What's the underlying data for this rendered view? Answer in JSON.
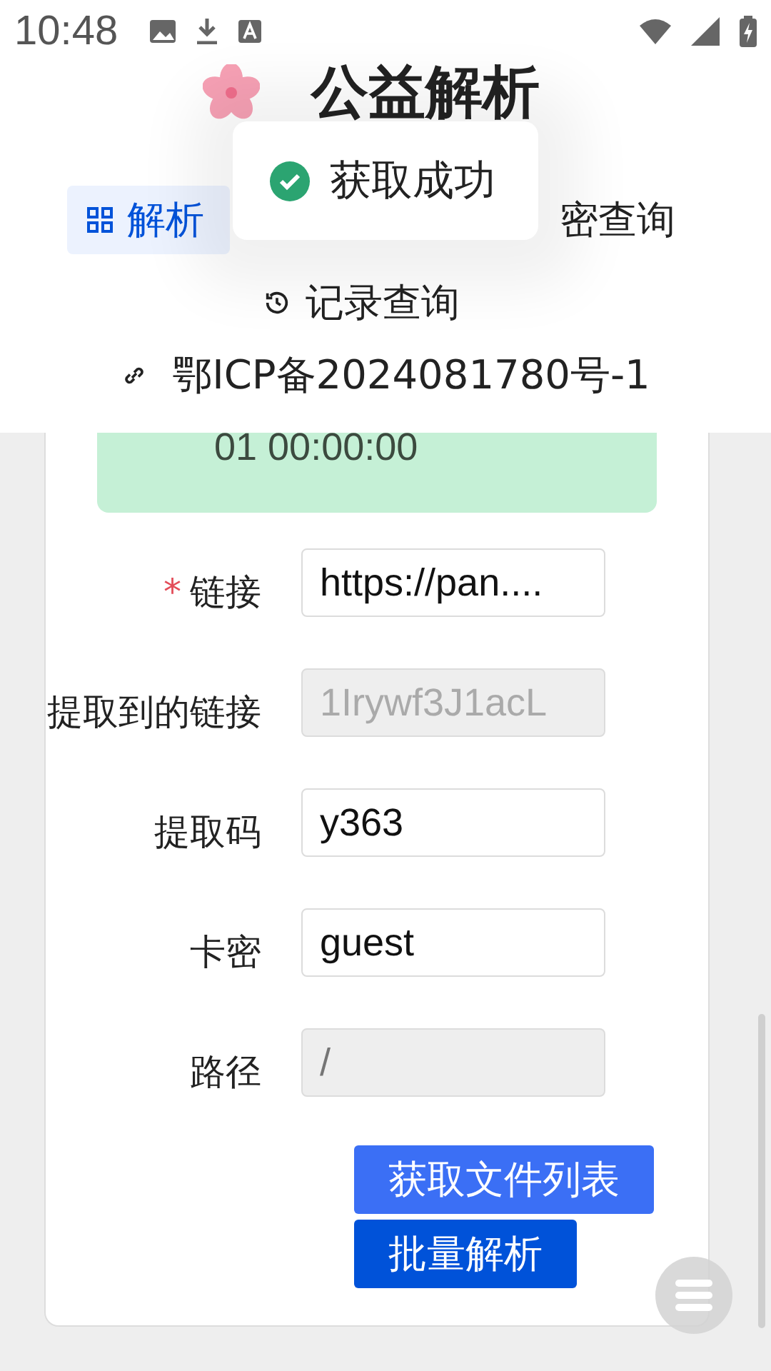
{
  "status_bar": {
    "time": "10:48"
  },
  "header": {
    "title": "公益解析",
    "tabs": [
      {
        "label": "解析",
        "selected": true
      },
      {
        "label": "密查询",
        "selected": false
      },
      {
        "label": "记录查询",
        "selected": false
      }
    ],
    "icp_link": "鄂ICP备2024081780号-1"
  },
  "toast": {
    "text": "获取成功",
    "kind": "success"
  },
  "notice": {
    "text": "01 00:00:00"
  },
  "form": {
    "required_mark": "*",
    "fields": [
      {
        "label": "链接",
        "value": "https://pan....",
        "required": true,
        "disabled": false
      },
      {
        "label": "提取到的链接",
        "value": "1Irywf3J1acL",
        "required": false,
        "disabled": true
      },
      {
        "label": "提取码",
        "value": "y363",
        "required": false,
        "disabled": false
      },
      {
        "label": "卡密",
        "value": "guest",
        "required": false,
        "disabled": false
      },
      {
        "label": "路径",
        "placeholder": "/",
        "required": false,
        "disabled": true
      }
    ],
    "buttons": [
      {
        "label": "获取文件列表",
        "kind": "primary"
      },
      {
        "label": "批量解析",
        "kind": "dark"
      }
    ]
  }
}
